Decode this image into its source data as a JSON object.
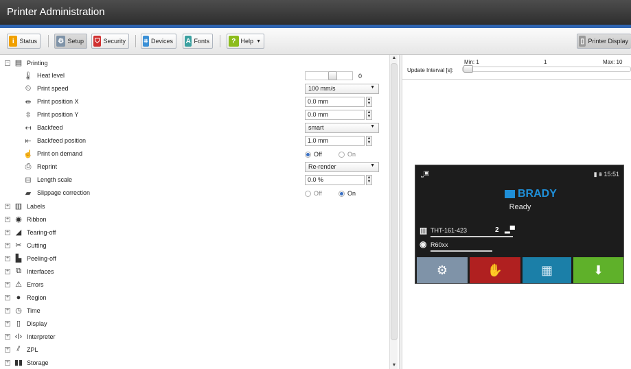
{
  "app": {
    "title": "Printer Administration"
  },
  "toolbar": {
    "status": "Status",
    "setup": "Setup",
    "security": "Security",
    "devices": "Devices",
    "fonts": "Fonts",
    "help": "Help",
    "printer_display": "Printer Display"
  },
  "tree": {
    "printing": {
      "label": "Printing",
      "items": {
        "heat_level": {
          "label": "Heat level",
          "value": "0"
        },
        "print_speed": {
          "label": "Print speed",
          "value": "100 mm/s"
        },
        "print_pos_x": {
          "label": "Print position X",
          "value": "0.0 mm"
        },
        "print_pos_y": {
          "label": "Print position Y",
          "value": "0.0 mm"
        },
        "backfeed": {
          "label": "Backfeed",
          "value": "smart"
        },
        "backfeed_pos": {
          "label": "Backfeed position",
          "value": "1.0 mm"
        },
        "print_on_demand": {
          "label": "Print on demand",
          "off": "Off",
          "on": "On",
          "selected": "Off"
        },
        "reprint": {
          "label": "Reprint",
          "value": "Re-render"
        },
        "length_scale": {
          "label": "Length scale",
          "value": "0.0 %"
        },
        "slippage": {
          "label": "Slippage correction",
          "off": "Off",
          "on": "On",
          "selected": "On"
        }
      }
    },
    "categories": [
      "Labels",
      "Ribbon",
      "Tearing-off",
      "Cutting",
      "Peeling-off",
      "Interfaces",
      "Errors",
      "Region",
      "Time",
      "Display",
      "Interpreter",
      "ZPL",
      "Storage"
    ],
    "labels": "Labels",
    "ribbon": "Ribbon",
    "tearing": "Tearing-off",
    "cutting": "Cutting",
    "peeling": "Peeling-off",
    "interfaces": "Interfaces",
    "errors": "Errors",
    "region": "Region",
    "time": "Time",
    "display": "Display",
    "interpreter": "Interpreter",
    "zpl": "ZPL",
    "storage": "Storage"
  },
  "update": {
    "label": "Update Interval [s]:",
    "min": "Min: 1",
    "current": "1",
    "max": "Max: 10"
  },
  "printer_display": {
    "time": "15:51",
    "brand": "BRADY",
    "status": "Ready",
    "job": "THT-161-423",
    "count": "2",
    "ribbon": "R60xx"
  },
  "colors": {
    "accent": "#2f64b0",
    "status_btn": "#f0a000",
    "security_btn": "#d03030",
    "devices_btn": "#3a8fd6",
    "fonts_btn": "#3aa0a0",
    "help_btn": "#8cbc1c",
    "disp_settings": "#7f93a8",
    "disp_stop": "#b02020",
    "disp_menu": "#1b7fa8",
    "disp_feed": "#5fb12a"
  }
}
